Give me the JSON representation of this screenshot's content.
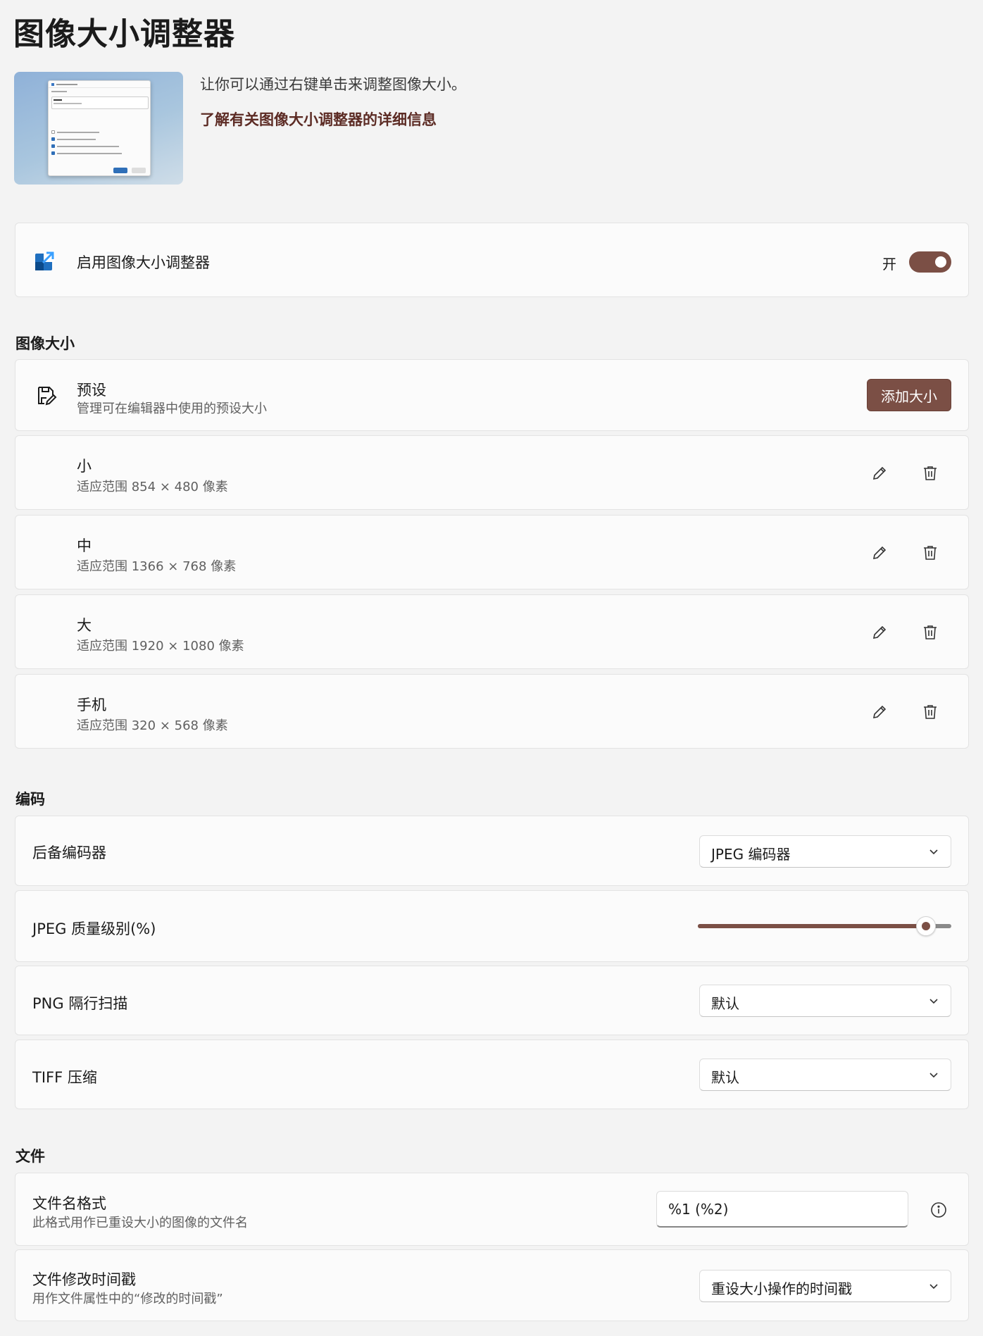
{
  "page": {
    "title": "图像大小调整器",
    "description": "让你可以通过右键单击来调整图像大小。",
    "learn_more_link": "了解有关图像大小调整器的详细信息"
  },
  "enable_card": {
    "label": "启用图像大小调整器",
    "toggle_state_label": "开",
    "toggle_on": true,
    "icon": "image-resizer-icon"
  },
  "image_size": {
    "header": "图像大小",
    "presets": {
      "title": "预设",
      "subtitle": "管理可在编辑器中使用的预设大小",
      "add_button": "添加大小",
      "icon": "save-edit-icon"
    },
    "sizes": [
      {
        "name": "小",
        "prefix": "适应范围",
        "width": "854",
        "times": "×",
        "height": "480",
        "unit": "像素"
      },
      {
        "name": "中",
        "prefix": "适应范围",
        "width": "1366",
        "times": "×",
        "height": "768",
        "unit": "像素"
      },
      {
        "name": "大",
        "prefix": "适应范围",
        "width": "1920",
        "times": "×",
        "height": "1080",
        "unit": "像素"
      },
      {
        "name": "手机",
        "prefix": "适应范围",
        "width": "320",
        "times": "×",
        "height": "568",
        "unit": "像素"
      }
    ]
  },
  "encoding": {
    "header": "编码",
    "fallback_encoder": {
      "label": "后备编码器",
      "value": "JPEG 编码器"
    },
    "jpeg_quality": {
      "label": "JPEG 质量级别(%)",
      "value_percent": 90
    },
    "png_interlace": {
      "label": "PNG 隔行扫描",
      "value": "默认"
    },
    "tiff_compression": {
      "label": "TIFF 压缩",
      "value": "默认"
    }
  },
  "file": {
    "header": "文件",
    "filename_format": {
      "title": "文件名格式",
      "subtitle": "此格式用作已重设大小的图像的文件名",
      "value": "%1 (%2)",
      "info_icon": "info-icon"
    },
    "file_timestamp": {
      "title": "文件修改时间戳",
      "subtitle": "用作文件属性中的“修改的时间戳”",
      "value": "重设大小操作的时间戳"
    }
  },
  "colors": {
    "accent": "#7b4f45",
    "link": "#5c2b24",
    "background": "#f3f3f3",
    "card": "#fbfbfb"
  }
}
